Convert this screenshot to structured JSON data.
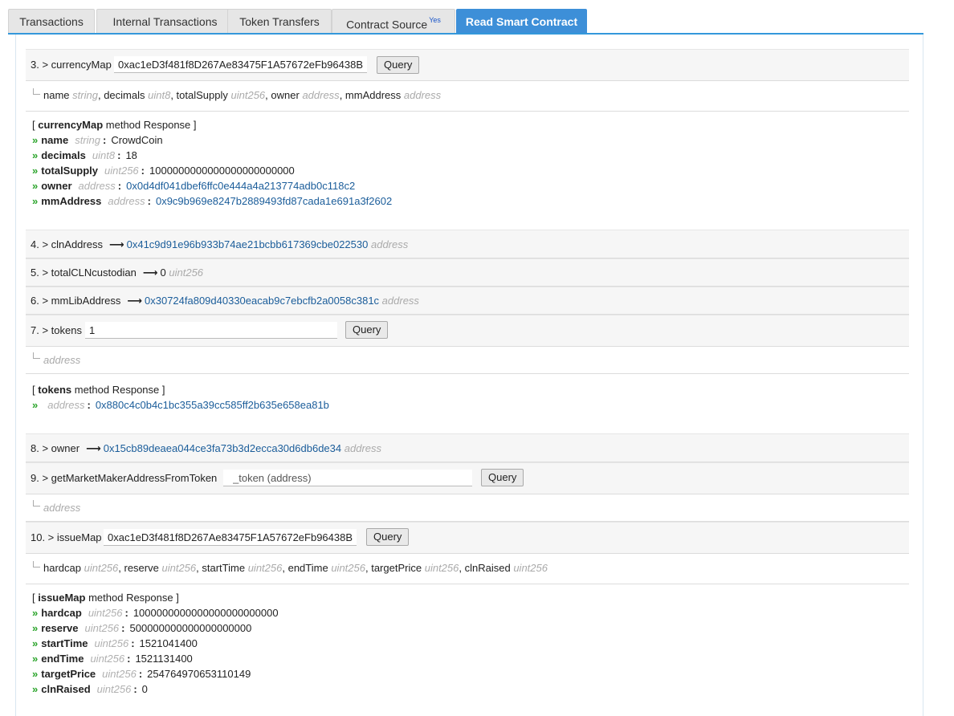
{
  "tabs": [
    {
      "label": "Transactions",
      "sup": ""
    },
    {
      "label": "Internal Transactions",
      "sup": ""
    },
    {
      "label": "Token Transfers",
      "sup": ""
    },
    {
      "label": "Contract Source",
      "sup": "Yes"
    },
    {
      "label": "Read Smart Contract",
      "sup": ""
    }
  ],
  "active_tab": "Read Smart Contract",
  "query_label": "Query",
  "m3": {
    "label": "3. > currencyMap",
    "input_value": "0xac1eD3f481f8D267Ae83475F1A57672eFb96438B",
    "outputs": [
      {
        "name": "name",
        "type": "string"
      },
      {
        "name": "decimals",
        "type": "uint8"
      },
      {
        "name": "totalSupply",
        "type": "uint256"
      },
      {
        "name": "owner",
        "type": "address"
      },
      {
        "name": "mmAddress",
        "type": "address"
      }
    ],
    "response_head_pre": "[ ",
    "response_method": "currencyMap",
    "response_head_post": " method Response ]",
    "response": [
      {
        "name": "name",
        "type": "string",
        "value": "CrowdCoin",
        "link": false
      },
      {
        "name": "decimals",
        "type": "uint8",
        "value": "18",
        "link": false
      },
      {
        "name": "totalSupply",
        "type": "uint256",
        "value": "1000000000000000000000000",
        "link": false
      },
      {
        "name": "owner",
        "type": "address",
        "value": "0x0d4df041dbef6ffc0e444a4a213774adb0c118c2",
        "link": true
      },
      {
        "name": "mmAddress",
        "type": "address",
        "value": "0x9c9b969e8247b2889493fd87cada1e691a3f2602",
        "link": true
      }
    ]
  },
  "m4": {
    "label": "4. > clnAddress",
    "value": "0x41c9d91e96b933b74ae21bcbb617369cbe022530",
    "type": "address"
  },
  "m5": {
    "label": "5. > totalCLNcustodian",
    "value": "0",
    "type": "uint256"
  },
  "m6": {
    "label": "6. > mmLibAddress",
    "value": "0x30724fa809d40330eacab9c7ebcfb2a0058c381c",
    "type": "address"
  },
  "m7": {
    "label": "7. > tokens",
    "input_value": "1",
    "output_type": "address",
    "response_head_pre": "[ ",
    "response_method": "tokens",
    "response_head_post": " method Response ]",
    "response_type": "address",
    "response_value": "0x880c4c0b4c1bc355a39cc585ff2b635e658ea81b"
  },
  "m8": {
    "label": "8. > owner",
    "value": "0x15cb89deaea044ce3fa73b3d2ecca30d6db6de34",
    "type": "address"
  },
  "m9": {
    "label": "9. > getMarketMakerAddressFromToken",
    "placeholder": "_token (address)",
    "output_type": "address"
  },
  "m10": {
    "label": "10. > issueMap",
    "input_value": "0xac1eD3f481f8D267Ae83475F1A57672eFb96438B",
    "outputs": [
      {
        "name": "hardcap",
        "type": "uint256"
      },
      {
        "name": "reserve",
        "type": "uint256"
      },
      {
        "name": "startTime",
        "type": "uint256"
      },
      {
        "name": "endTime",
        "type": "uint256"
      },
      {
        "name": "targetPrice",
        "type": "uint256"
      },
      {
        "name": "clnRaised",
        "type": "uint256"
      }
    ],
    "response_head_pre": "[ ",
    "response_method": "issueMap",
    "response_head_post": " method Response ]",
    "response": [
      {
        "name": "hardcap",
        "type": "uint256",
        "value": "1000000000000000000000000",
        "link": false
      },
      {
        "name": "reserve",
        "type": "uint256",
        "value": "500000000000000000000",
        "link": false
      },
      {
        "name": "startTime",
        "type": "uint256",
        "value": "1521041400",
        "link": false
      },
      {
        "name": "endTime",
        "type": "uint256",
        "value": "1521131400",
        "link": false
      },
      {
        "name": "targetPrice",
        "type": "uint256",
        "value": "254764970653110149",
        "link": false
      },
      {
        "name": "clnRaised",
        "type": "uint256",
        "value": "0",
        "link": false
      }
    ]
  },
  "colors": {
    "accent": "#3d8fd8",
    "link": "#1b5d9a",
    "type": "#aaaaaa",
    "chevron": "#2ba42b"
  }
}
